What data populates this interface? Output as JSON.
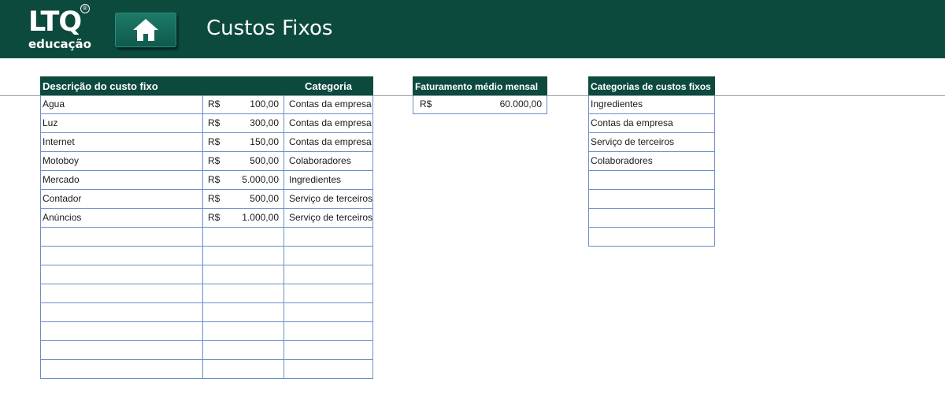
{
  "header": {
    "logo_text": "LTQ",
    "logo_registered": "®",
    "logo_subtext": "educação",
    "title": "Custos Fixos",
    "home_icon": "home-icon"
  },
  "colors": {
    "header_bg": "#0d4a3e",
    "grid_line": "#6b8fc9"
  },
  "costs_table": {
    "header_description": "Descrição do custo fixo",
    "header_category": "Categoria",
    "rows": [
      {
        "description": "Agua",
        "currency": "R$",
        "value": "100,00",
        "category": "Contas da empresa"
      },
      {
        "description": "Luz",
        "currency": "R$",
        "value": "300,00",
        "category": "Contas da empresa"
      },
      {
        "description": "Internet",
        "currency": "R$",
        "value": "150,00",
        "category": "Contas da empresa"
      },
      {
        "description": "Motoboy",
        "currency": "R$",
        "value": "500,00",
        "category": "Colaboradores"
      },
      {
        "description": "Mercado",
        "currency": "R$",
        "value": "5.000,00",
        "category": "Ingredientes"
      },
      {
        "description": "Contador",
        "currency": "R$",
        "value": "500,00",
        "category": "Serviço de terceiros"
      },
      {
        "description": "Anúncios",
        "currency": "R$",
        "value": "1.000,00",
        "category": "Serviço de terceiros"
      },
      {
        "description": "",
        "currency": "",
        "value": "",
        "category": ""
      },
      {
        "description": "",
        "currency": "",
        "value": "",
        "category": ""
      },
      {
        "description": "",
        "currency": "",
        "value": "",
        "category": ""
      },
      {
        "description": "",
        "currency": "",
        "value": "",
        "category": ""
      },
      {
        "description": "",
        "currency": "",
        "value": "",
        "category": ""
      },
      {
        "description": "",
        "currency": "",
        "value": "",
        "category": ""
      },
      {
        "description": "",
        "currency": "",
        "value": "",
        "category": ""
      },
      {
        "description": "",
        "currency": "",
        "value": "",
        "category": ""
      }
    ]
  },
  "revenue_table": {
    "header": "Faturamento médio mensal",
    "currency": "R$",
    "value": "60.000,00"
  },
  "categories_table": {
    "header": "Categorias de custos fixos",
    "items": [
      "Ingredientes",
      "Contas da empresa",
      "Serviço de terceiros",
      "Colaboradores",
      "",
      "",
      "",
      ""
    ]
  }
}
